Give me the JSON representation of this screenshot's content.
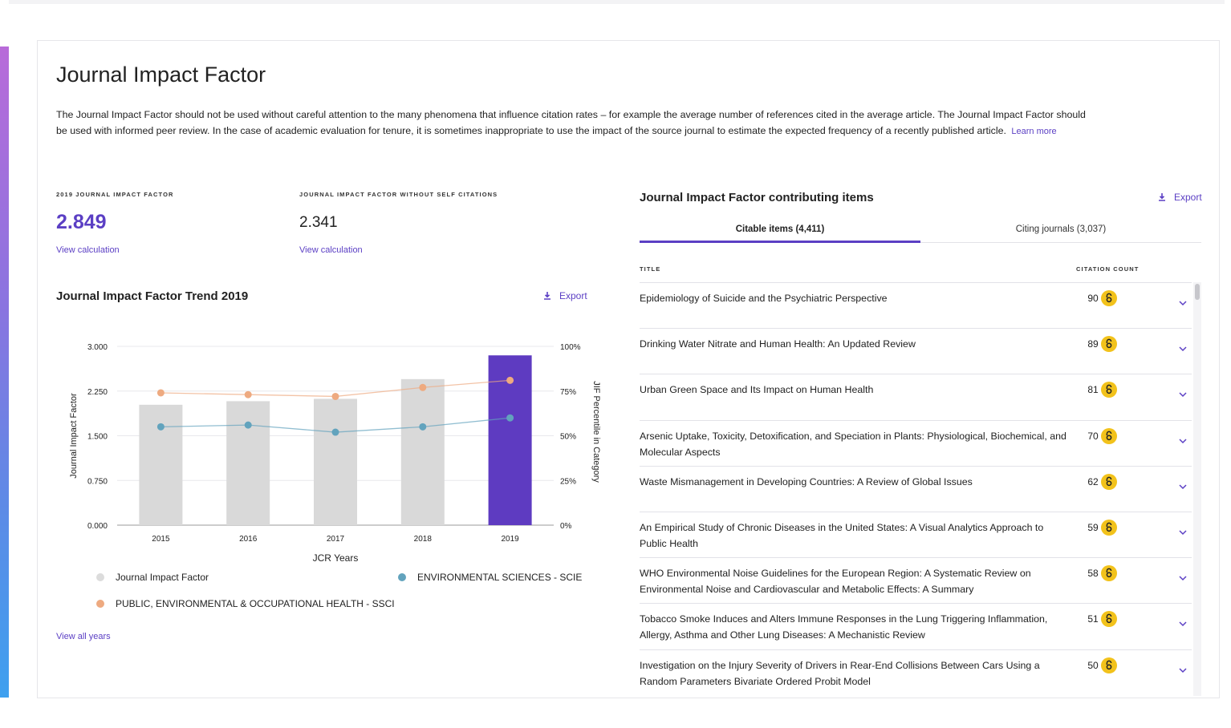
{
  "page": {
    "title": "Journal Impact Factor",
    "description": "The Journal Impact Factor should not be used without careful attention to the many phenomena that influence citation rates – for example the average number of references cited in the average article. The Journal Impact Factor should be used with informed peer review. In the case of academic evaluation for tenure, it is sometimes inappropriate to use the impact of the source journal to estimate the expected frequency of a recently published article.",
    "learn_more": "Learn more"
  },
  "metrics": {
    "jif": {
      "label": "2019 JOURNAL IMPACT FACTOR",
      "value": "2.849",
      "link": "View calculation"
    },
    "jif_no_self": {
      "label": "JOURNAL IMPACT FACTOR WITHOUT SELF CITATIONS",
      "value": "2.341",
      "link": "View calculation"
    }
  },
  "trend": {
    "title": "Journal Impact Factor Trend 2019",
    "export": "Export",
    "view_all": "View all years",
    "legend": [
      "Journal Impact Factor",
      "ENVIRONMENTAL SCIENCES - SCIE",
      "PUBLIC, ENVIRONMENTAL & OCCUPATIONAL HEALTH - SSCI"
    ]
  },
  "chart_data": {
    "type": "bar",
    "categories": [
      "2015",
      "2016",
      "2017",
      "2018",
      "2019"
    ],
    "xlabel": "JCR Years",
    "ylabel": "Journal Impact Factor",
    "y2label": "JIF Percentile in Category",
    "ylim": [
      0,
      3
    ],
    "y_ticks": [
      "3.000",
      "2.250",
      "1.500",
      "0.750",
      "0.000"
    ],
    "y2lim": [
      0,
      100
    ],
    "y2_ticks": [
      "100%",
      "75%",
      "50%",
      "25%",
      "0%"
    ],
    "grid": true,
    "series": [
      {
        "name": "Journal Impact Factor",
        "kind": "bar",
        "axis": "left",
        "values": [
          2.02,
          2.08,
          2.12,
          2.45,
          2.849
        ],
        "color": "#d9d9d9",
        "highlight_color": "#5e3bc1"
      },
      {
        "name": "PUBLIC, ENVIRONMENTAL & OCCUPATIONAL HEALTH - SSCI",
        "kind": "line",
        "axis": "right",
        "values": [
          74,
          73,
          72,
          77,
          81
        ],
        "color": "#eeaa80"
      },
      {
        "name": "ENVIRONMENTAL SCIENCES - SCIE",
        "kind": "line",
        "axis": "right",
        "values": [
          55,
          56,
          52,
          55,
          60
        ],
        "color": "#62a3bd"
      }
    ]
  },
  "contributing": {
    "title": "Journal Impact Factor contributing items",
    "export": "Export",
    "tabs": [
      "Citable items (4,411)",
      "Citing journals (3,037)"
    ],
    "col_title": "TITLE",
    "col_count": "CITATION COUNT",
    "items": [
      {
        "title": "Epidemiology of Suicide and the Psychiatric Perspective",
        "count": "90"
      },
      {
        "title": "Drinking Water Nitrate and Human Health: An Updated Review",
        "count": "89"
      },
      {
        "title": "Urban Green Space and Its Impact on Human Health",
        "count": "81"
      },
      {
        "title": "Arsenic Uptake, Toxicity, Detoxification, and Speciation in Plants: Physiological, Biochemical, and Molecular Aspects",
        "count": "70"
      },
      {
        "title": "Waste Mismanagement in Developing Countries: A Review of Global Issues",
        "count": "62"
      },
      {
        "title": "An Empirical Study of Chronic Diseases in the United States: A Visual Analytics Approach to Public Health",
        "count": "59"
      },
      {
        "title": "WHO Environmental Noise Guidelines for the European Region: A Systematic Review on Environmental Noise and Cardiovascular and Metabolic Effects: A Summary",
        "count": "58"
      },
      {
        "title": "Tobacco Smoke Induces and Alters Immune Responses in the Lung Triggering Inflammation, Allergy, Asthma and Other Lung Diseases: A Mechanistic Review",
        "count": "51"
      },
      {
        "title": "Investigation on the Injury Severity of Drivers in Rear-End Collisions Between Cars Using a Random Parameters Bivariate Ordered Probit Model",
        "count": "50"
      }
    ],
    "item_icons": [
      "open-access-icon",
      "chevron-down-icon"
    ]
  },
  "colors": {
    "accent": "#5b3fc4",
    "oa_badge": "#f2c21b"
  }
}
